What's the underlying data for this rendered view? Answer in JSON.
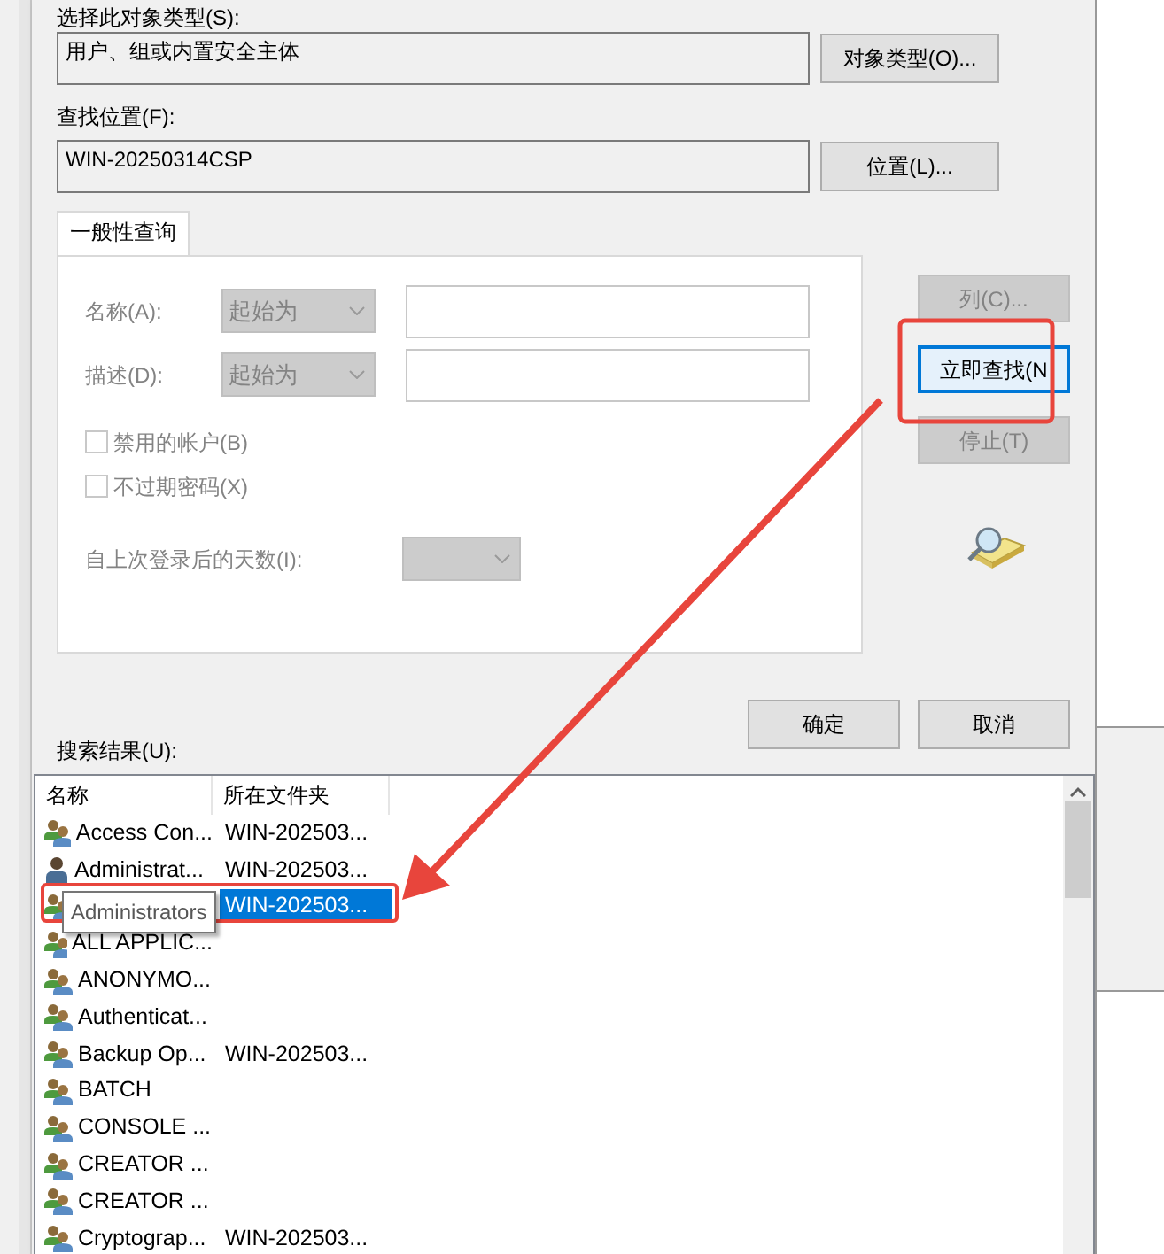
{
  "object_type": {
    "label": "选择此对象类型(S):",
    "value": "用户、组或内置安全主体",
    "button": "对象类型(O)..."
  },
  "location": {
    "label": "查找位置(F):",
    "value": "WIN-20250314CSP",
    "button": "位置(L)..."
  },
  "tabs": [
    {
      "label": "一般性查询",
      "selected": true
    }
  ],
  "query": {
    "disabled": true,
    "fields": [
      {
        "label": "名称(A):",
        "mode": "起始为"
      },
      {
        "label": "描述(D):",
        "mode": "起始为"
      }
    ],
    "checkboxes": [
      {
        "label": "禁用的帐户(B)",
        "checked": false
      },
      {
        "label": "不过期密码(X)",
        "checked": false
      }
    ],
    "days_label": "自上次登录后的天数(I):"
  },
  "side_buttons": [
    {
      "label": "列(C)...",
      "disabled": true,
      "focused": false
    },
    {
      "label": "立即查找(N",
      "disabled": false,
      "focused": true
    },
    {
      "label": "停止(T)",
      "disabled": true,
      "focused": false
    }
  ],
  "dialog_buttons": [
    "确定",
    "取消"
  ],
  "results": {
    "label": "搜索结果(U):",
    "columns": [
      "名称",
      "所在文件夹"
    ],
    "rows": [
      {
        "kind": "group",
        "name": "Access Con...",
        "folder": "WIN-202503...",
        "selected": false
      },
      {
        "kind": "user",
        "name": "Administrat...",
        "folder": "WIN-202503...",
        "selected": false
      },
      {
        "kind": "group",
        "folder": "WIN-202503...",
        "selected": true,
        "tooltip": "Administrators"
      },
      {
        "kind": "group",
        "name": "ALL APPLIC...",
        "selected": false
      },
      {
        "kind": "group",
        "name": "ANONYMO...",
        "selected": false
      },
      {
        "kind": "group",
        "name": "Authenticat...",
        "selected": false
      },
      {
        "kind": "group",
        "name": "Backup Op...",
        "folder": "WIN-202503...",
        "selected": false
      },
      {
        "kind": "group",
        "name": "BATCH",
        "selected": false
      },
      {
        "kind": "group",
        "name": "CONSOLE ...",
        "selected": false
      },
      {
        "kind": "group",
        "name": "CREATOR ...",
        "selected": false
      },
      {
        "kind": "group",
        "name": "CREATOR ...",
        "selected": false
      },
      {
        "kind": "group",
        "name": "Cryptograp...",
        "folder": "WIN-202503...",
        "selected": false
      }
    ]
  }
}
